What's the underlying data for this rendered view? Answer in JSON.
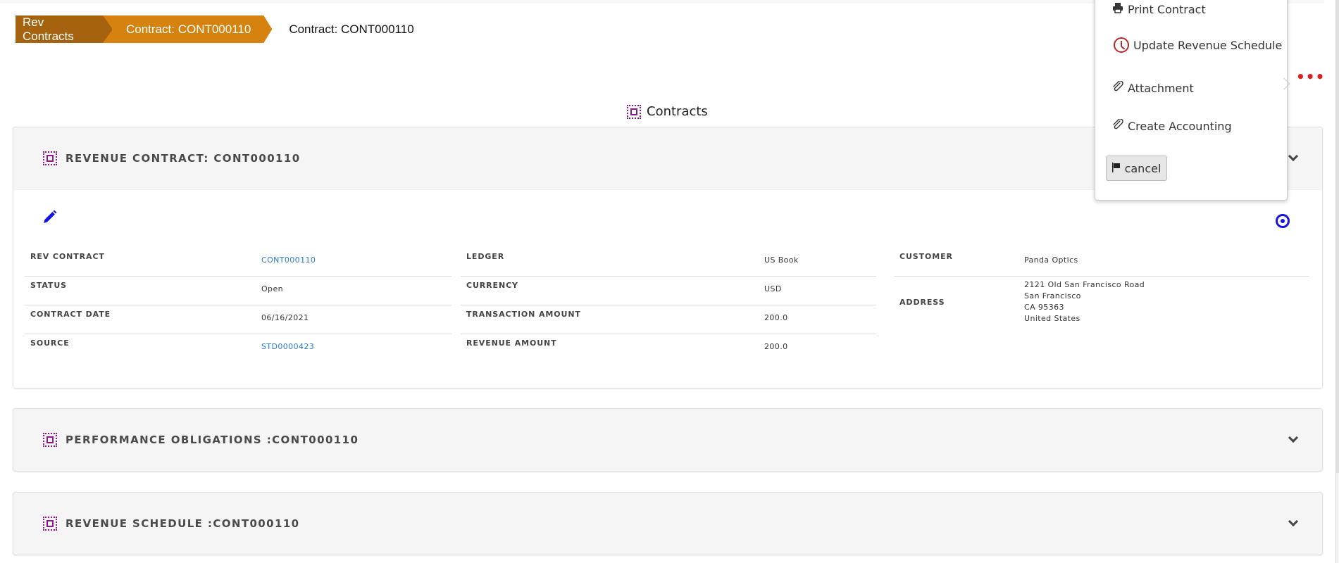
{
  "breadcrumb": {
    "items": [
      {
        "label": "Rev Contracts"
      },
      {
        "label": "Contract: CONT000110"
      }
    ],
    "current": "Contract: CONT000110"
  },
  "more_menu_icon": "ellipsis-icon",
  "page_title": "Contracts",
  "menu": {
    "items": [
      {
        "label": "Print Contract",
        "icon": "printer-icon"
      },
      {
        "label": "Update Revenue Schedule",
        "icon": "clock-icon"
      },
      {
        "label": "Attachment",
        "icon": "paperclip-icon",
        "has_submenu": true
      },
      {
        "label": "Create Accounting",
        "icon": "paperclip-icon"
      }
    ],
    "cancel_label": "cancel"
  },
  "panels": {
    "revenue_contract": {
      "title": "REVENUE CONTRACT: CONT000110",
      "fields_left": [
        {
          "label": "REV CONTRACT",
          "value": "CONT000110",
          "link": true
        },
        {
          "label": "STATUS",
          "value": "Open"
        },
        {
          "label": "CONTRACT DATE",
          "value": "06/16/2021"
        },
        {
          "label": "SOURCE",
          "value": "STD0000423",
          "link": true
        }
      ],
      "fields_middle": [
        {
          "label": "LEDGER",
          "value": "US Book"
        },
        {
          "label": "CURRENCY",
          "value": "USD"
        },
        {
          "label": "TRANSACTION AMOUNT",
          "value": "200.0"
        },
        {
          "label": "REVENUE AMOUNT",
          "value": "200.0"
        }
      ],
      "fields_right": {
        "customer_label": "CUSTOMER",
        "customer": "Panda Optics",
        "address_label": "ADDRESS",
        "address_lines": [
          "2121 Old San Francisco Road",
          "San Francisco",
          "CA 95363",
          "United States"
        ]
      }
    },
    "performance_obligations": {
      "title": "PERFORMANCE OBLIGATIONS :CONT000110"
    },
    "revenue_schedule": {
      "title": "REVENUE SCHEDULE :CONT000110"
    }
  },
  "colors": {
    "breadcrumb_primary": "#a5620f",
    "breadcrumb_secondary": "#d5820f",
    "icon_accent": "#8a1a8a",
    "link": "#2a7bd5",
    "edit_icon": "#1414e6",
    "more_dots": "#dd2222"
  }
}
